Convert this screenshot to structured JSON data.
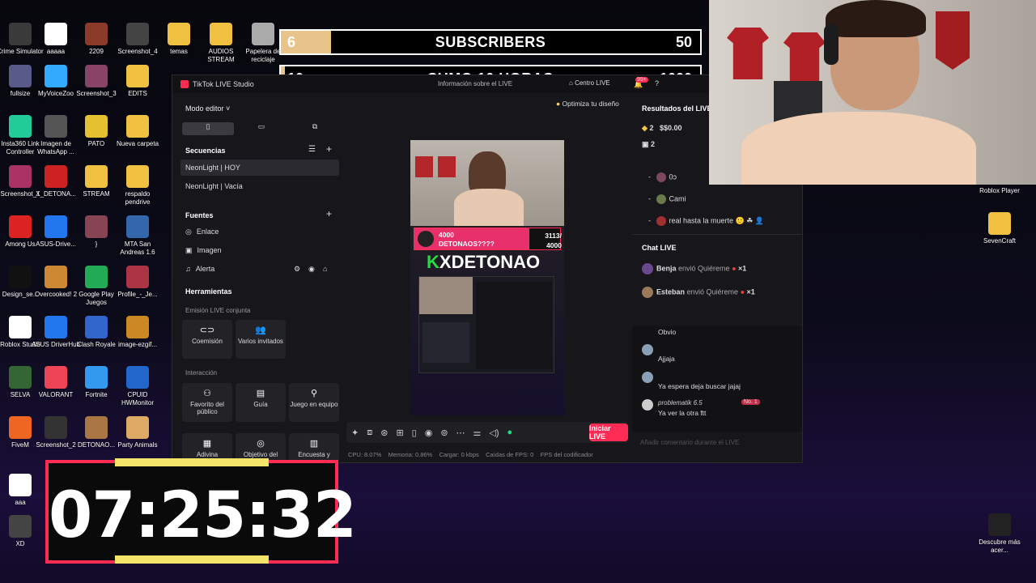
{
  "desktop_icons": [
    {
      "label": "Crime Simulator",
      "color": "#3a3a3a"
    },
    {
      "label": "aaaaa",
      "color": "#ffffff"
    },
    {
      "label": "2209",
      "color": "#8c3b2b"
    },
    {
      "label": "Screenshot_4",
      "color": "#444"
    },
    {
      "label": "temas",
      "color": "#f0c040"
    },
    {
      "label": "AUDIOS STREAM",
      "color": "#f0c040"
    },
    {
      "label": "Papelera de reciclaje",
      "color": "#aaa"
    },
    {
      "label": "fullsize",
      "color": "#5a5a8a"
    },
    {
      "label": "MyVoiceZoo",
      "color": "#33aaff"
    },
    {
      "label": "Screenshot_3",
      "color": "#884466"
    },
    {
      "label": "EDITS",
      "color": "#f0c040"
    },
    {
      "label": "Insta360 Link Controller",
      "color": "#22cc99"
    },
    {
      "label": "Imagen de WhatsApp ...",
      "color": "#555"
    },
    {
      "label": "PATO",
      "color": "#e5c030"
    },
    {
      "label": "Nueva carpeta",
      "color": "#f0c040"
    },
    {
      "label": "Screenshot_1",
      "color": "#aa3366"
    },
    {
      "label": "X_DETONA...",
      "color": "#cc2222"
    },
    {
      "label": "STREAM",
      "color": "#f0c040"
    },
    {
      "label": "respaldo pendrive",
      "color": "#f0c040"
    },
    {
      "label": "Among Us",
      "color": "#dd2222"
    },
    {
      "label": "ASUS-Drive...",
      "color": "#2277ee"
    },
    {
      "label": "}",
      "color": "#884455"
    },
    {
      "label": "MTA San Andreas 1.6",
      "color": "#3366aa"
    },
    {
      "label": "Design_se...",
      "color": "#111"
    },
    {
      "label": "Overcooked! 2",
      "color": "#cc8833"
    },
    {
      "label": "Google Play Juegos",
      "color": "#22aa55"
    },
    {
      "label": "Profile_-_Je...",
      "color": "#aa3344"
    },
    {
      "label": "Roblox Studio",
      "color": "#ffffff"
    },
    {
      "label": "ASUS DriverHub",
      "color": "#2277ee"
    },
    {
      "label": "Clash Royale",
      "color": "#3366cc"
    },
    {
      "label": "image-ezgif...",
      "color": "#cc8822"
    },
    {
      "label": "SELVA",
      "color": "#336633"
    },
    {
      "label": "VALORANT",
      "color": "#ee4455"
    },
    {
      "label": "Fortnite",
      "color": "#3399ee"
    },
    {
      "label": "CPUID HWMonitor",
      "color": "#2266cc"
    },
    {
      "label": "FiveM",
      "color": "#ee6622"
    },
    {
      "label": "Screenshot_2",
      "color": "#333"
    },
    {
      "label": "DETONAO...",
      "color": "#aa7744"
    },
    {
      "label": "Party Animals",
      "color": "#ddaa66"
    },
    {
      "label": "aaa",
      "color": "#ffffff"
    },
    {
      "label": "XD",
      "color": "#444"
    },
    {
      "label": "Roblox Player",
      "color": "#333"
    },
    {
      "label": "SevenCraft",
      "color": "#f0c040"
    },
    {
      "label": "Descubre más acer...",
      "color": "#222"
    }
  ],
  "bars": {
    "subscribers": {
      "left": "6",
      "title": "SUBSCRIBERS",
      "right": "50",
      "progress": 0.12
    },
    "hours": {
      "left": "10",
      "title": "SUMO 10 HORAS",
      "right": "1000",
      "progress": 0.01
    }
  },
  "studio": {
    "app_title": "TikTok LIVE Studio",
    "header_center_text": "Información sobre el LIVE",
    "header_center_live": "Centro LIVE",
    "notif_count": "99+",
    "mode_editor": "Modo editor",
    "sequences_label": "Secuencias",
    "sequences": [
      "NeonLight | HOY",
      "NeonLight | Vacía"
    ],
    "sources_label": "Fuentes",
    "sources": [
      "Enlace",
      "Imagen",
      "Alerta"
    ],
    "tools_label": "Herramientas",
    "joint_live_label": "Emisión LIVE conjunta",
    "joint_tools": [
      "Coemisión",
      "Varios invitados"
    ],
    "interaction_label": "Interacción",
    "interaction_tools": [
      "Favorito del público",
      "Guía",
      "Juego en equipo"
    ],
    "more_tools": [
      "Adivina",
      "Objetivo del",
      "Encuesta y"
    ],
    "optimize_label": "Optimiza tu diseño",
    "go_live": "Iniciar LIVE",
    "stats": {
      "cpu": "CPU: 8.07%",
      "memory": "Memoria: 0.86%",
      "load": "Cargar: 0 kbps",
      "fps_drops": "Caídas de FPS: 0",
      "encoder": "FPS del codificador"
    }
  },
  "preview": {
    "goal_count": "4000",
    "goal_label": "DETONAOS????",
    "goal_progress_text": "3113/ 4000",
    "goal_progress": 0.78,
    "brand": "XDETONAO",
    "brand_letter": "K"
  },
  "results": {
    "title": "Resultados del LIVE",
    "diamonds": "2",
    "money": "$0.00",
    "gifts": "2",
    "viewers": [
      "0ɔ",
      "Cami",
      "real hasta la muerte 🙂 ☘ 👤"
    ]
  },
  "chat": {
    "title": "Chat LIVE",
    "gift_rows": [
      {
        "user": "Benja",
        "action": "envió Quiéreme",
        "count": "×1"
      },
      {
        "user": "Esteban",
        "action": "envió Quiéreme",
        "count": "×1"
      }
    ],
    "messages": [
      {
        "user": "",
        "text": "Obvio"
      },
      {
        "user": "",
        "text": "Ajjaja"
      },
      {
        "user": "",
        "text": "Ya espera deja buscar jajaj"
      },
      {
        "user": "problematik 6.5",
        "badge": "No. 1",
        "text": "Ya ver la otra ftt"
      }
    ],
    "input_placeholder": "Añadir comentario durante el LIVE"
  },
  "timer": {
    "value": "07:25:32"
  },
  "colors": {
    "accent": "#fe2c55",
    "bar_fill": "#e8c48a"
  }
}
